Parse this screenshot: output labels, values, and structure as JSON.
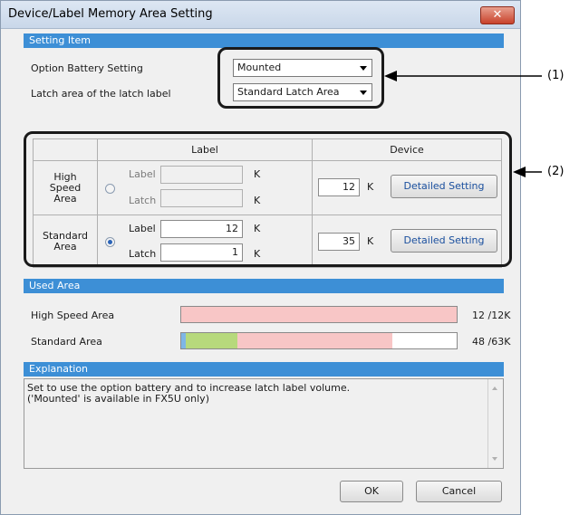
{
  "window": {
    "title": "Device/Label Memory Area Setting",
    "close_glyph": "✕"
  },
  "setting_item": {
    "header": "Setting Item",
    "battery": {
      "label": "Option Battery Setting",
      "value": "Mounted"
    },
    "latch": {
      "label": "Latch area of the latch label",
      "value": "Standard Latch Area"
    }
  },
  "grid": {
    "col_label": "Label",
    "col_device": "Device",
    "high_speed": {
      "name": "High Speed Area",
      "label_caption": "Label",
      "label_value": "",
      "label_unit": "K",
      "latch_caption": "Latch",
      "latch_value": "",
      "latch_unit": "K",
      "device_value": "12",
      "device_unit": "K",
      "selected": false
    },
    "standard": {
      "name": "Standard Area",
      "label_caption": "Label",
      "label_value": "12",
      "label_unit": "K",
      "latch_caption": "Latch",
      "latch_value": "1",
      "latch_unit": "K",
      "device_value": "35",
      "device_unit": "K",
      "selected": true
    },
    "detailed_button": "Detailed Setting"
  },
  "used_area": {
    "header": "Used Area",
    "high_speed": {
      "label": "High Speed Area",
      "text": "12 /12K",
      "used_fraction": 1.0
    },
    "standard": {
      "label": "Standard Area",
      "text": "48 /63K",
      "segments": [
        {
          "fraction": 0.015,
          "color": "#7fb6e6"
        },
        {
          "fraction": 0.19,
          "color": "#b7d97c"
        },
        {
          "fraction": 0.56,
          "color": "#f8c6c6"
        }
      ]
    }
  },
  "explanation": {
    "header": "Explanation",
    "text": "Set to use the option battery and to increase latch label volume.\n('Mounted' is available in FX5U only)"
  },
  "buttons": {
    "ok": "OK",
    "cancel": "Cancel"
  },
  "callouts": {
    "one": "(1)",
    "two": "(2)"
  },
  "colors": {
    "section_header": "#3d8fd6",
    "bar_used": "#f8c6c6",
    "bar_green": "#b7d97c"
  }
}
